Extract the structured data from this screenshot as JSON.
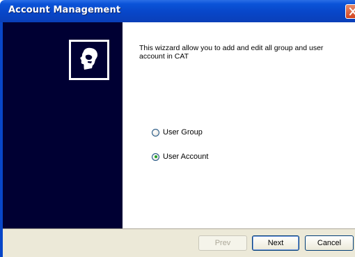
{
  "window": {
    "title": "Account Management"
  },
  "icons": {
    "close": "close-icon",
    "logo": "user-head-logo-icon"
  },
  "description": "This wizzard allow you to add and edit all group and user account in CAT",
  "options": [
    {
      "label": "User Group",
      "selected": false
    },
    {
      "label": "User Account",
      "selected": true
    }
  ],
  "buttons": {
    "prev": {
      "label": "Prev",
      "enabled": false
    },
    "next": {
      "label": "Next",
      "enabled": true
    },
    "cancel": {
      "label": "Cancel",
      "enabled": true
    }
  },
  "colors": {
    "titlebar": "#0846c8",
    "sidebar": "#000033",
    "footer": "#ece9d8",
    "radio_selected": "#21a121"
  }
}
